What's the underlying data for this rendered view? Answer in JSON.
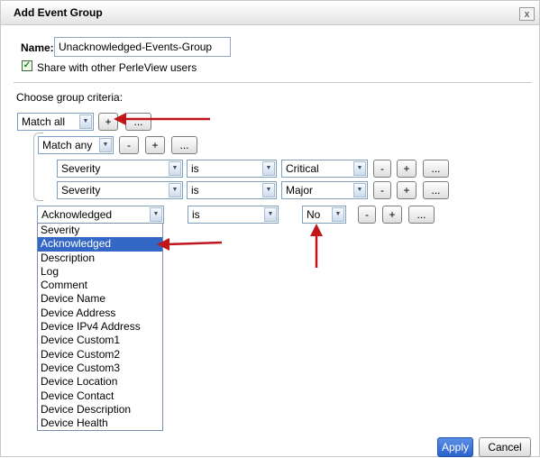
{
  "dialog": {
    "title": "Add Event Group",
    "close_label": "x"
  },
  "name_field": {
    "label": "Name:",
    "value": "Unacknowledged-Events-Group"
  },
  "share": {
    "checked": true,
    "label": "Share with other PerleView users"
  },
  "criteria": {
    "heading": "Choose group criteria:",
    "top_match": "Match all",
    "inner_match": "Match any",
    "buttons": {
      "minus": "-",
      "plus": "+",
      "more": "..."
    },
    "rows": [
      {
        "field": "Severity",
        "operator": "is",
        "value": "Critical"
      },
      {
        "field": "Severity",
        "operator": "is",
        "value": "Major"
      }
    ],
    "new_row": {
      "field": "Acknowledged",
      "operator": "is",
      "value": "No"
    }
  },
  "field_options": [
    "Severity",
    "Acknowledged",
    "Description",
    "Log",
    "Comment",
    "Device Name",
    "Device Address",
    "Device IPv4 Address",
    "Device Custom1",
    "Device Custom2",
    "Device Custom3",
    "Device Location",
    "Device Contact",
    "Device Description",
    "Device Health"
  ],
  "selected_option": "Acknowledged",
  "footer": {
    "apply": "Apply",
    "cancel": "Cancel"
  },
  "colors": {
    "annotation_arrow": "#c0161b",
    "selection_highlight": "#3367c5",
    "primary_button": "#2a62cc"
  }
}
